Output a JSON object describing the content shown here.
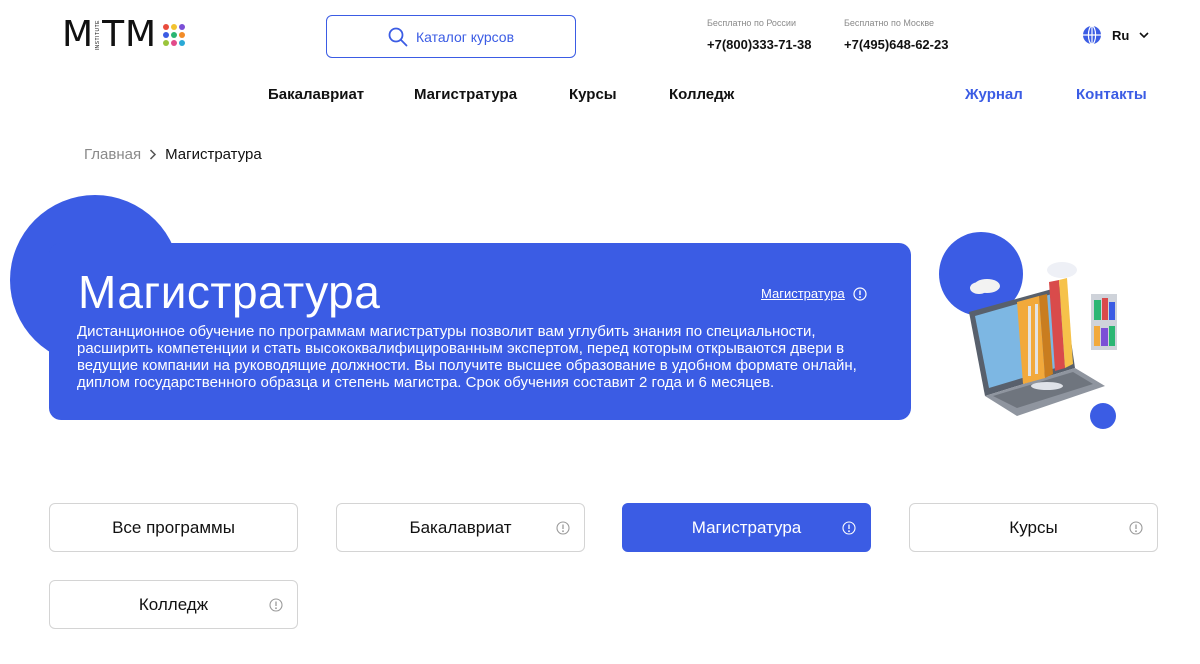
{
  "header": {
    "logo": {
      "text": "MITM",
      "sub": "INSTITUTE",
      "dot_colors": [
        "#e94b3c",
        "#f2c230",
        "#7b4fd6",
        "#3b5ce4",
        "#2bb673",
        "#f28c28",
        "#9ac43b",
        "#e24b8a",
        "#2aa9d6"
      ]
    },
    "search": {
      "label": "Каталог курсов"
    },
    "phones": [
      {
        "caption": "Бесплатно по России",
        "number": "+7(800)333-71-38"
      },
      {
        "caption": "Бесплатно по Москве",
        "number": "+7(495)648-62-23"
      }
    ],
    "language": {
      "label": "Ru",
      "icon": "globe-icon"
    }
  },
  "nav": {
    "items": [
      "Бакалавриат",
      "Магистратура",
      "Курсы",
      "Колледж"
    ],
    "journal": "Журнал",
    "contacts": "Контакты"
  },
  "breadcrumb": {
    "home": "Главная",
    "current": "Магистратура"
  },
  "hero": {
    "title": "Магистратура",
    "description": "Дистанционное обучение по программам магистратуры позволит вам углубить знания по специальности, расширить компетенции и стать высококвалифицированным экспертом, перед которым открываются двери в ведущие компании на руководящие должности. Вы получите высшее образование в удобном формате онлайн, диплом государственного образца и степень магистра. Срок обучения составит 2 года и 6 месяцев.",
    "tag": "Магистратура"
  },
  "filters": [
    {
      "label": "Все программы",
      "active": false,
      "info": false
    },
    {
      "label": "Бакалавриат",
      "active": false,
      "info": true
    },
    {
      "label": "Магистратура",
      "active": true,
      "info": true
    },
    {
      "label": "Курсы",
      "active": false,
      "info": true
    },
    {
      "label": "Колледж",
      "active": false,
      "info": true
    }
  ],
  "colors": {
    "accent": "#3b5ce4",
    "text": "#111111",
    "muted": "#8a8a8a",
    "border": "#d4d4d4"
  }
}
